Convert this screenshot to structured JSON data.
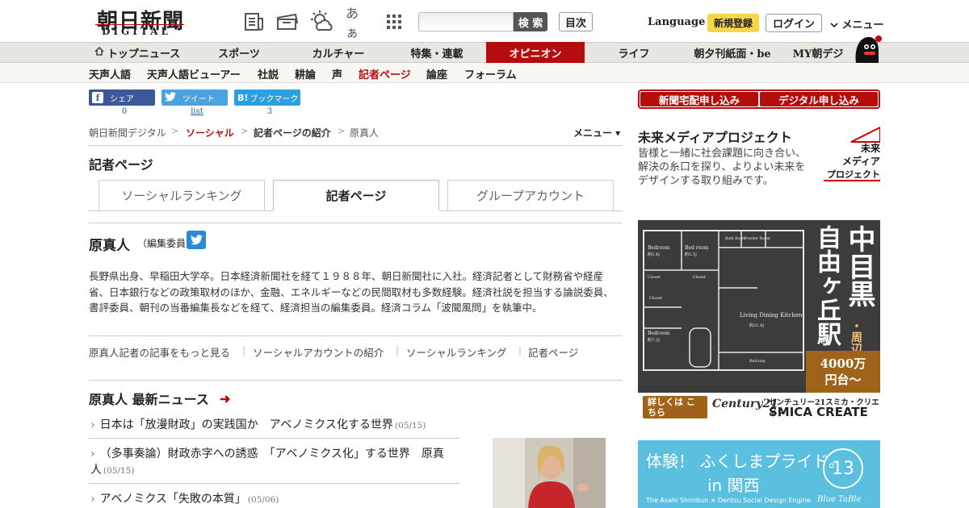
{
  "header": {
    "logo": "朝日新聞",
    "logo_sub": "DIGITAL",
    "icons": [
      "newspaper-icon",
      "coupon-icon",
      "weather-icon",
      "font-size-icon",
      "grid-menu-icon"
    ],
    "font_icon_text": "あぁ",
    "search_placeholder": "",
    "search_button": "検 索",
    "toc_button": "目次",
    "language": "Language",
    "register": "新規登録",
    "login": "ログイン",
    "menu": "メニュー"
  },
  "nav": [
    {
      "label": "トップニュース",
      "active": false
    },
    {
      "label": "スポーツ",
      "active": false
    },
    {
      "label": "カルチャー",
      "active": false
    },
    {
      "label": "特集・連載",
      "active": false
    },
    {
      "label": "オピニオン",
      "active": true
    },
    {
      "label": "ライフ",
      "active": false
    },
    {
      "label": "朝夕刊紙面・be",
      "active": false
    },
    {
      "label": "MY朝デジ",
      "active": false
    }
  ],
  "subnav": [
    {
      "label": "天声人語",
      "active": false
    },
    {
      "label": "天声人語ビューアー",
      "active": false
    },
    {
      "label": "社説",
      "active": false
    },
    {
      "label": "耕論",
      "active": false
    },
    {
      "label": "声",
      "active": false
    },
    {
      "label": "記者ページ",
      "active": true
    },
    {
      "label": "論座",
      "active": false
    },
    {
      "label": "フォーラム",
      "active": false
    }
  ],
  "share": {
    "facebook": {
      "label": "シェア",
      "count": "0"
    },
    "twitter": {
      "label": "ツイート",
      "count": "list"
    },
    "hatena": {
      "label": "ブックマーク",
      "count": "3"
    }
  },
  "breadcrumb": [
    "朝日新聞デジタル",
    "ソーシャル",
    "記者ページの紹介",
    "原真人"
  ],
  "breadcrumb_menu": "メニュー ▾",
  "section_title": "記者ページ",
  "tabs": [
    "ソーシャルランキング",
    "記者ページ",
    "グループアカウント"
  ],
  "profile": {
    "name": "原真人",
    "role": "（編集委員）",
    "bio": "長野県出身、早稲田大学卒。日本経済新聞社を経て１９８８年、朝日新聞社に入社。経済記者として財務省や経産省、日本銀行などの政策取材のほか、金融、エネルギーなどの民間取材も多数経験。経済社説を担当する論説委員、書評委員、朝刊の当番編集長などを経て、経済担当の編集委員。経済コラム「波聞風問」を執筆中。"
  },
  "links": [
    "原真人記者の記事をもっと見る",
    "ソーシャルアカウントの紹介",
    "ソーシャルランキング",
    "記者ページ"
  ],
  "news": {
    "heading": "原真人 最新ニュース",
    "items": [
      {
        "title": "日本は「放漫財政」の実践国か　アベノミクス化する世界",
        "date": "(05/15)"
      },
      {
        "title": "（多事奏論）財政赤字への誘惑　「アベノミクス化」する世界　原真人",
        "date": "(05/15)"
      },
      {
        "title": "アベノミクス「失敗の本質」",
        "date": "(05/06)"
      }
    ]
  },
  "sidebar": {
    "subscribe_paper": "新聞宅配申し込み",
    "subscribe_digital": "デジタル申し込み",
    "mirai_title": "未来メディアプロジェクト",
    "mirai_text": "皆様と一緒に社会課題に向き合い、解決の糸口を探り、よりよい未来をデザインする取り組みです。",
    "mirai_logo": [
      "未来",
      "メディア",
      "プロジェクト"
    ]
  },
  "ad_realestate": {
    "rooms": [
      "Bedroom",
      "Bed room",
      "Bath Room",
      "Powder Room",
      "Closet",
      "Closet",
      "Closet",
      "Living Dining Kitchen",
      "Bedroom",
      "Balcony"
    ],
    "sizes": [
      "約5.4J",
      "約5.5J",
      "約22.4J",
      "約7.2J"
    ],
    "headline_a": "中目黒",
    "headline_b": "自由ヶ丘駅",
    "headline_c": "・周辺",
    "price_a": "4000万",
    "price_b": "円台〜",
    "detail": "詳しくは こちら",
    "brand_a": "Century21",
    "brand_b": "センチュリー21スミカ・クリエイト",
    "brand_c": "SMICA CREATE"
  },
  "ad_fukushima": {
    "line1": "体験！ ふくしまプライド。",
    "line2": "in 関西",
    "credit": "The Asahi Shimbun × Dentsu Social Design Engine",
    "badge": "13",
    "brand": "Blue TaBle"
  }
}
